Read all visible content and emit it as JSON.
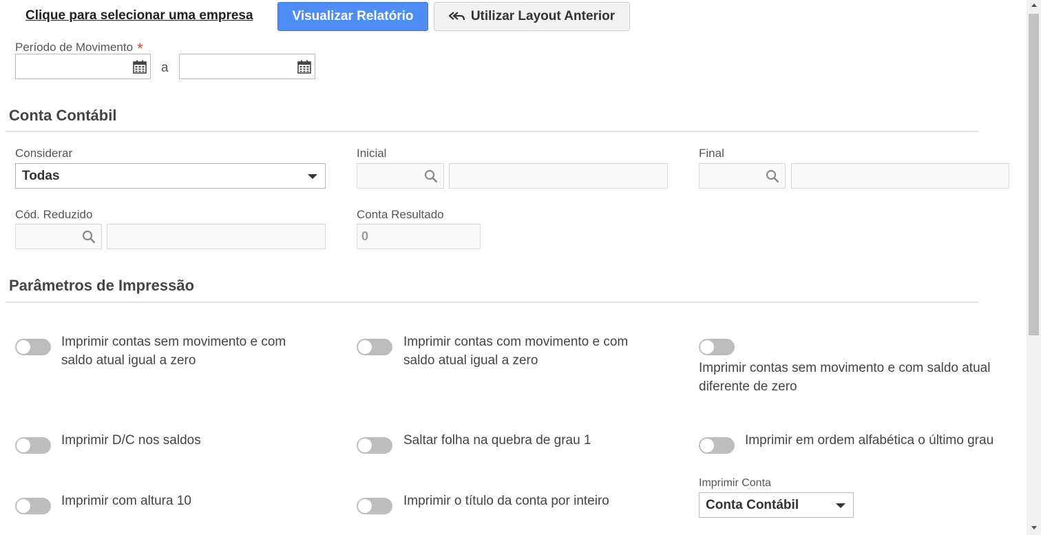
{
  "header": {
    "company_link": "Clique para selecionar uma empresa",
    "view_report_button": "Visualizar Relatório",
    "previous_layout_button": "Utilizar Layout Anterior"
  },
  "period": {
    "label": "Período de Movimento",
    "required_marker": "*",
    "separator": "a",
    "start_value": "",
    "end_value": ""
  },
  "conta_contabil": {
    "title": "Conta Contábil",
    "considerar_label": "Considerar",
    "considerar_value": "Todas",
    "inicial_label": "Inicial",
    "final_label": "Final",
    "cod_reduzido_label": "Cód. Reduzido",
    "conta_resultado_label": "Conta Resultado",
    "conta_resultado_value": "0"
  },
  "impressao": {
    "title": "Parâmetros de Impressão",
    "options": [
      {
        "label": "Imprimir contas sem movimento e com saldo atual igual a zero",
        "checked": false
      },
      {
        "label": "Imprimir contas com movimento e com saldo atual igual a zero",
        "checked": false
      },
      {
        "label": "Imprimir contas sem movimento e com saldo atual diferente de zero",
        "checked": false
      },
      {
        "label": "Imprimir D/C nos saldos",
        "checked": false
      },
      {
        "label": "Saltar folha na quebra de grau 1",
        "checked": false
      },
      {
        "label": "Imprimir em ordem alfabética o último grau",
        "checked": false
      },
      {
        "label": "Imprimir com altura 10",
        "checked": false
      },
      {
        "label": "Imprimir o título da conta por inteiro",
        "checked": false
      }
    ],
    "imprimir_conta_label": "Imprimir Conta",
    "imprimir_conta_value": "Conta Contábil"
  },
  "colors": {
    "primary": "#4d8df5",
    "required": "#d9412e",
    "toggle_off": "#bdbdbd"
  }
}
